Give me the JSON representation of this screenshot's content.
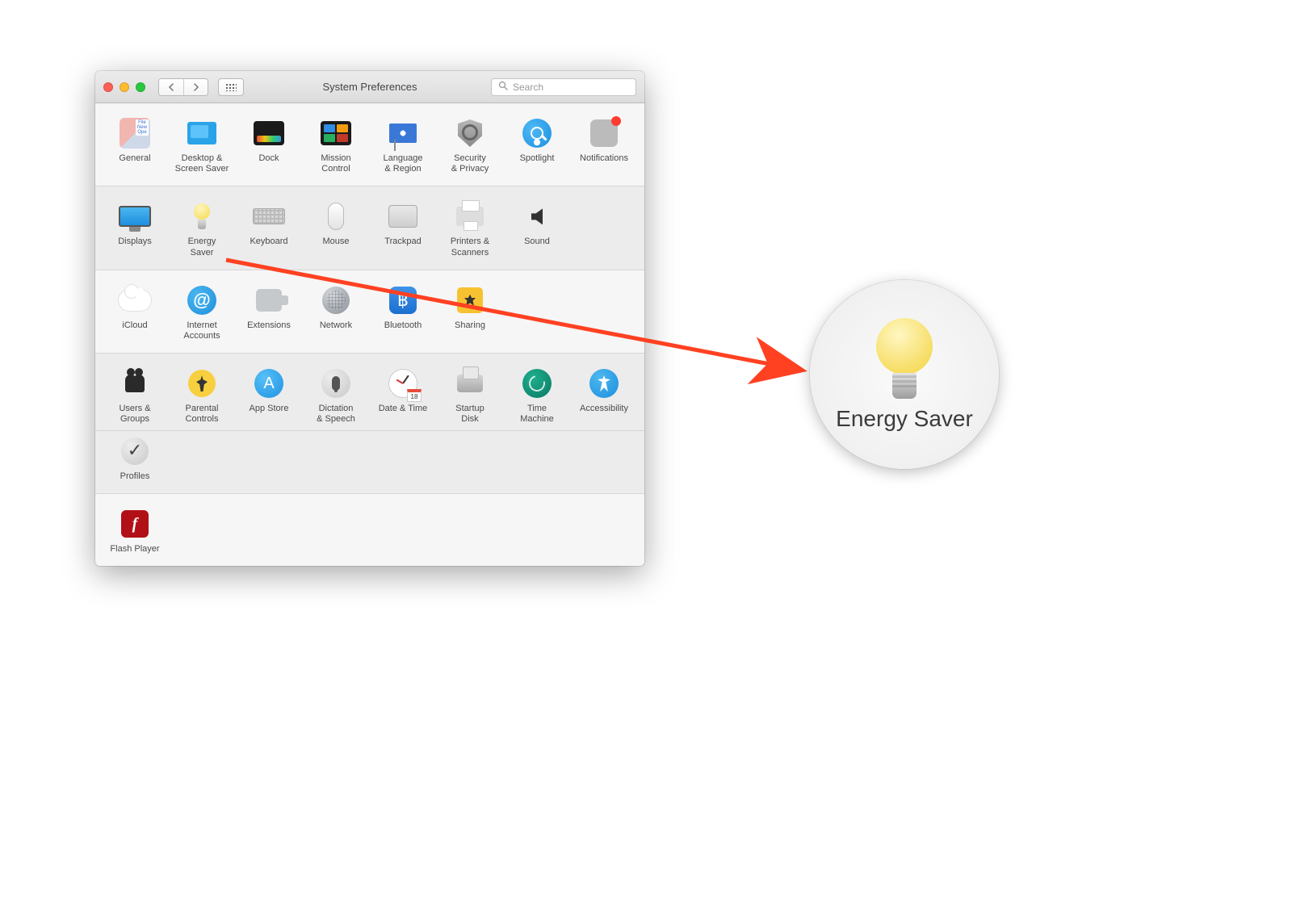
{
  "window": {
    "title": "System Preferences",
    "search_placeholder": "Search"
  },
  "rows": [
    [
      {
        "id": "general",
        "label": "General"
      },
      {
        "id": "desktop",
        "label": "Desktop &\nScreen Saver"
      },
      {
        "id": "dock",
        "label": "Dock"
      },
      {
        "id": "mission",
        "label": "Mission\nControl"
      },
      {
        "id": "language",
        "label": "Language\n& Region"
      },
      {
        "id": "security",
        "label": "Security\n& Privacy"
      },
      {
        "id": "spotlight",
        "label": "Spotlight"
      },
      {
        "id": "notifications",
        "label": "Notifications"
      }
    ],
    [
      {
        "id": "displays",
        "label": "Displays"
      },
      {
        "id": "energy",
        "label": "Energy\nSaver"
      },
      {
        "id": "keyboard",
        "label": "Keyboard"
      },
      {
        "id": "mouse",
        "label": "Mouse"
      },
      {
        "id": "trackpad",
        "label": "Trackpad"
      },
      {
        "id": "printers",
        "label": "Printers &\nScanners"
      },
      {
        "id": "sound",
        "label": "Sound"
      }
    ],
    [
      {
        "id": "icloud",
        "label": "iCloud"
      },
      {
        "id": "internet",
        "label": "Internet\nAccounts"
      },
      {
        "id": "extensions",
        "label": "Extensions"
      },
      {
        "id": "network",
        "label": "Network"
      },
      {
        "id": "bluetooth",
        "label": "Bluetooth"
      },
      {
        "id": "sharing",
        "label": "Sharing"
      }
    ],
    [
      {
        "id": "users",
        "label": "Users &\nGroups"
      },
      {
        "id": "parental",
        "label": "Parental\nControls"
      },
      {
        "id": "appstore",
        "label": "App Store"
      },
      {
        "id": "dictation",
        "label": "Dictation\n& Speech"
      },
      {
        "id": "datetime",
        "label": "Date & Time"
      },
      {
        "id": "startup",
        "label": "Startup\nDisk"
      },
      {
        "id": "timemachine",
        "label": "Time\nMachine"
      },
      {
        "id": "accessibility",
        "label": "Accessibility"
      }
    ],
    [
      {
        "id": "profiles",
        "label": "Profiles"
      }
    ],
    [
      {
        "id": "flash",
        "label": "Flash Player"
      }
    ]
  ],
  "datetime_day": "18",
  "callout": {
    "label": "Energy\nSaver"
  }
}
